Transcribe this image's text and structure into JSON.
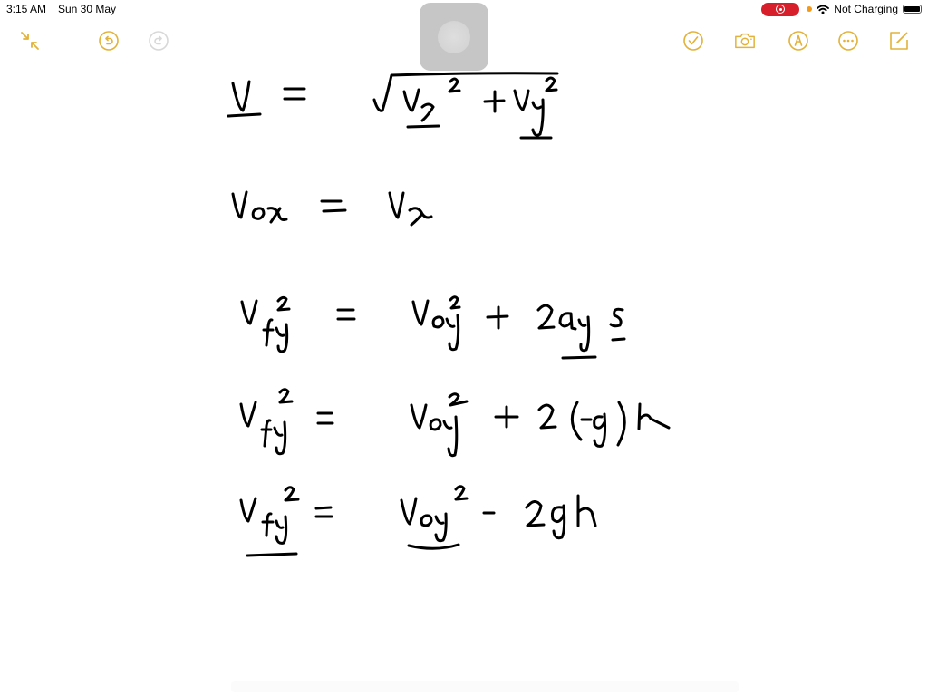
{
  "status_bar": {
    "time": "3:15 AM",
    "date": "Sun 30 May",
    "charging": "Not Charging",
    "icons": [
      "screen-record-icon",
      "mic-in-use-dot",
      "wifi-icon",
      "battery-icon"
    ]
  },
  "toolbar": {
    "accent_color": "#e2b23a",
    "disabled_color": "#d8d8d8",
    "left": [
      {
        "name": "collapse-icon",
        "label": "Minimize"
      },
      {
        "name": "undo-icon",
        "label": "Undo"
      },
      {
        "name": "redo-icon",
        "label": "Redo"
      }
    ],
    "right": [
      {
        "name": "checklist-icon",
        "label": "Checklist"
      },
      {
        "name": "camera-icon",
        "label": "Camera"
      },
      {
        "name": "markup-icon",
        "label": "Markup"
      },
      {
        "name": "more-icon",
        "label": "More"
      },
      {
        "name": "compose-icon",
        "label": "New Note"
      }
    ]
  },
  "note": {
    "equations": [
      {
        "lhs": "v",
        "rhs": "√(vₓ² + v_y²)"
      },
      {
        "lhs": "v₀ₓ",
        "rhs": "vₓ"
      },
      {
        "lhs": "v_fy²",
        "rhs": "v_oy² + 2a_y s"
      },
      {
        "lhs": "v_fy²",
        "rhs": "v_oy² + 2(-g)h"
      },
      {
        "lhs": "v_fy²",
        "rhs": "v_oy² - 2gh"
      }
    ]
  }
}
